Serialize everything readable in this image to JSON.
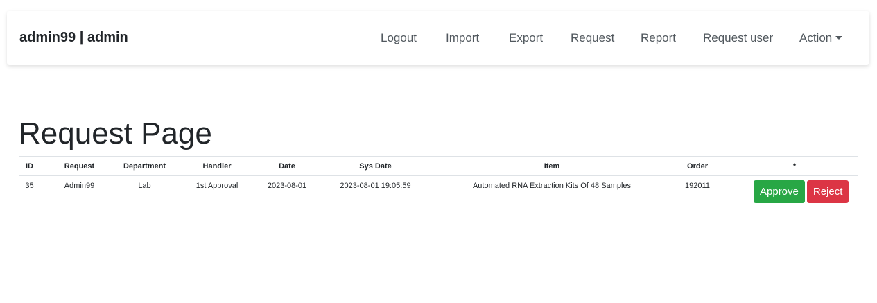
{
  "navbar": {
    "brand": "admin99 | admin",
    "items": [
      {
        "label": "Logout"
      },
      {
        "label": "Import"
      },
      {
        "label": "Export"
      },
      {
        "label": "Request"
      },
      {
        "label": "Report"
      },
      {
        "label": "Request user"
      },
      {
        "label": "Action"
      }
    ]
  },
  "page": {
    "title": "Request Page"
  },
  "table": {
    "columns": [
      "ID",
      "Request",
      "Department",
      "Handler",
      "Date",
      "Sys Date",
      "Item",
      "Order",
      "*"
    ],
    "rows": [
      {
        "id": "35",
        "request": "Admin99",
        "department": "Lab",
        "handler": "1st Approval",
        "date": "2023-08-01",
        "sys_date": "2023-08-01 19:05:59",
        "item": "Automated RNA Extraction Kits Of 48 Samples",
        "order": "192011",
        "approve_label": "Approve",
        "reject_label": "Reject"
      }
    ]
  },
  "colors": {
    "approve": "#28a745",
    "reject": "#dc3545",
    "nav_text": "#51585e",
    "text": "#212529"
  }
}
